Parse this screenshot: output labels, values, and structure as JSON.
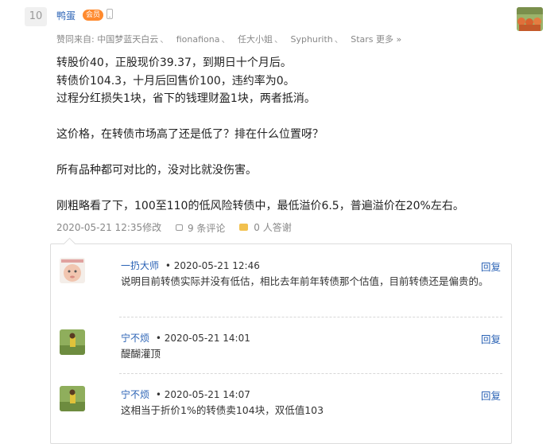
{
  "post": {
    "floor": "10",
    "author": "鸭蛋",
    "member_badge": "会员",
    "likes_prefix": "赞同来自:",
    "likers": [
      "中国梦蓝天白云",
      "fionafiona",
      "任大小姐",
      "Syphurith",
      "Stars"
    ],
    "likers_sep": "、",
    "likes_more": "更多 »",
    "content": [
      "转股价40，正股现价39.37，到期日十个月后。",
      "转债价104.3，十月后回售价100，违约率为0。",
      "过程分红损失1块，省下的钱理财盈1块，两者抵消。",
      "",
      "这价格，在转债市场高了还是低了？排在什么位置呀？",
      "",
      "所有品种都可对比的，没对比就没伤害。",
      "",
      "刚粗略看了下，100至110的低风险转债中，最低溢价6.5，普遍溢价在20%左右。"
    ],
    "timestamp": "2020-05-21 12:35修改",
    "comments": "9 条评论",
    "thanks": "0 人答谢"
  },
  "replies": [
    {
      "name": "一扔大师",
      "time": "• 2020-05-21 12:46",
      "reply_label": "回复",
      "text": "说明目前转债实际并没有低估，相比去年前年转债那个估值，目前转债还是偏贵的。"
    },
    {
      "name": "宁不烦",
      "time": "• 2020-05-21 14:01",
      "reply_label": "回复",
      "text": "醍醐灌顶"
    },
    {
      "name": "宁不烦",
      "time": "• 2020-05-21 14:07",
      "reply_label": "回复",
      "text": "这相当于折价1%的转债卖104块，双低值103"
    }
  ]
}
